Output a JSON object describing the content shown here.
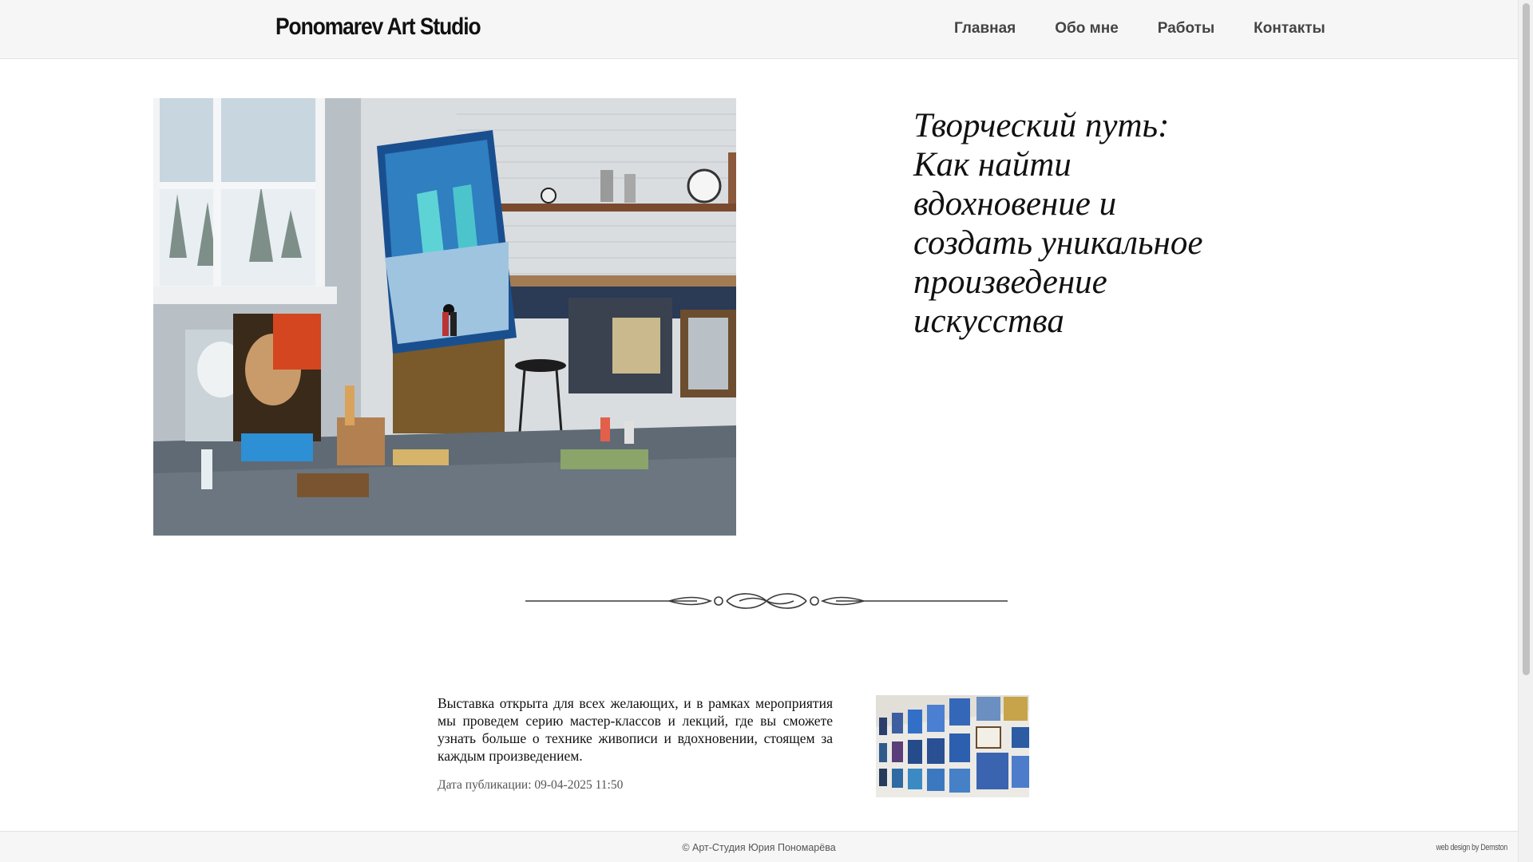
{
  "header": {
    "logo": "Ponomarev Art Studio",
    "nav": [
      {
        "label": "Главная"
      },
      {
        "label": "Обо мне"
      },
      {
        "label": "Работы"
      },
      {
        "label": "Контакты"
      }
    ]
  },
  "article": {
    "title": "Творческий путь: Как найти вдохновение и создать уникальное произведение искусства",
    "body": "Выставка открыта для всех желающих, и в рамках мероприятия мы проведем серию мастер-классов и лекций, где вы сможете узнать больше о технике живописи и вдохновении, стоящем за каждым произведением.",
    "date_label": "Дата публикации:",
    "date_value": "09-04-2025 11:50"
  },
  "footer": {
    "copyright": "© Арт-Студия Юрия Пономарёва",
    "credit": "web design by Demston"
  },
  "colors": {
    "header_bg": "#f6f6f6",
    "text": "#111111",
    "nav_text": "#444444",
    "muted": "#555555"
  },
  "icons": {
    "divider": "ornamental-divider-icon"
  }
}
